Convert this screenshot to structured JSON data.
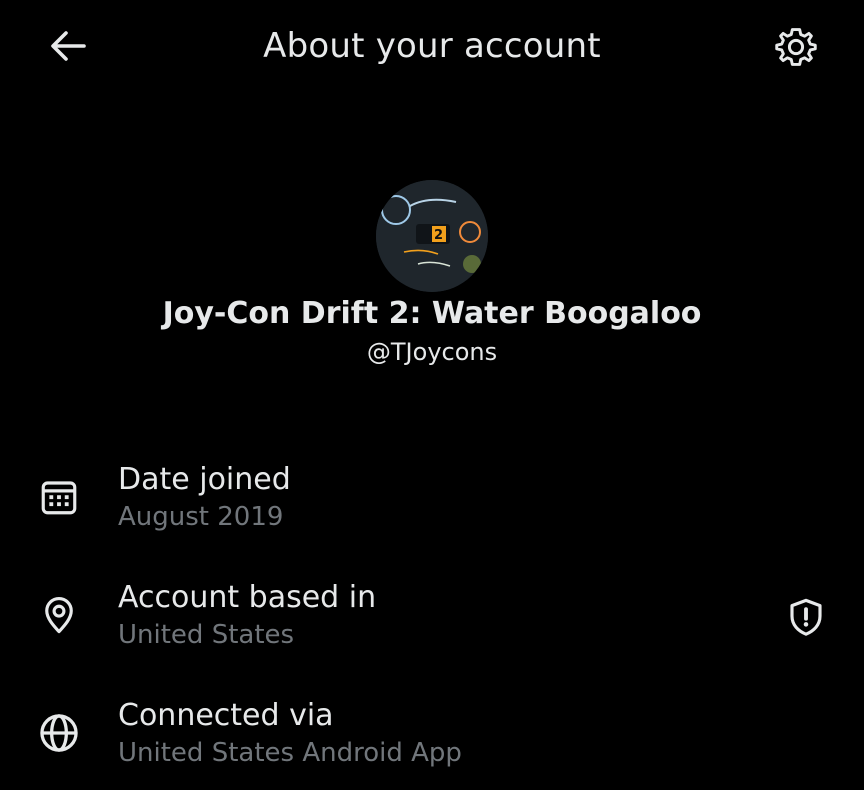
{
  "header": {
    "title": "About your account",
    "back_icon": "arrow-left-icon",
    "settings_icon": "gear-icon"
  },
  "profile": {
    "avatar_icon": "avatar",
    "display_name": "Joy-Con Drift 2: Water Boogaloo",
    "handle": "@TJoycons"
  },
  "rows": [
    {
      "icon": "calendar-icon",
      "label": "Date joined",
      "value": "August 2019"
    },
    {
      "icon": "location-pin-icon",
      "label": "Account based in",
      "value": "United States",
      "trailing_icon": "shield-alert-icon"
    },
    {
      "icon": "globe-icon",
      "label": "Connected via",
      "value": "United States Android App"
    }
  ],
  "colors": {
    "background": "#000000",
    "primary_text": "#e7e9ea",
    "secondary_text": "#71767b",
    "icon": "#e7e9ea"
  }
}
